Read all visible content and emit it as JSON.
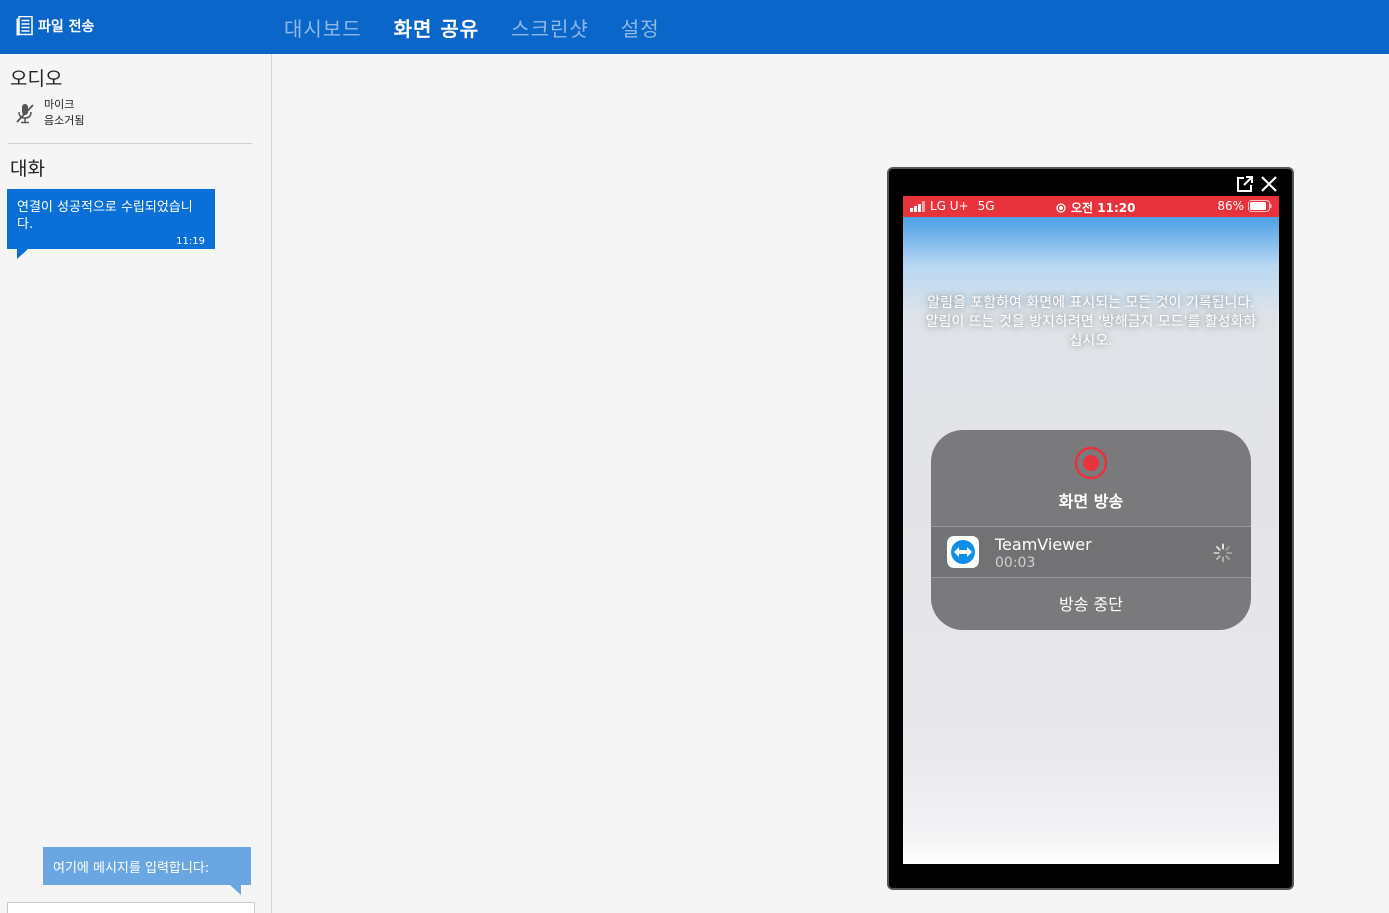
{
  "header": {
    "file_transfer_label": "파일 전송",
    "tabs": [
      {
        "label": "대시보드",
        "active": false
      },
      {
        "label": "화면 공유",
        "active": true
      },
      {
        "label": "스크린샷",
        "active": false
      },
      {
        "label": "설정",
        "active": false
      }
    ]
  },
  "sidebar": {
    "audio_title": "오디오",
    "mic": {
      "line1": "마이크",
      "line2": "음소거됨",
      "icon": "mic-muted-icon"
    },
    "chat_title": "대화",
    "messages": [
      {
        "text": "연결이 성공적으로 수립되었습니다.",
        "time": "11:19"
      }
    ],
    "input_placeholder": "여기에 메시지를 입력합니다:"
  },
  "phone": {
    "status": {
      "carrier": "LG U+",
      "network": "5G",
      "time": "오전 11:20",
      "battery": "86%"
    },
    "notice": "알림을 포함하여 화면에 표시되는 모든 것이 기록됩니다. 알림이 뜨는 것을 방지하려면 '방해금지 모드'를 활성화하십시오.",
    "panel": {
      "title": "화면 방송",
      "app_name": "TeamViewer",
      "elapsed": "00:03",
      "stop_label": "방송 중단"
    }
  },
  "colors": {
    "brand": "#0a66c8",
    "bubble": "#0a6fd6",
    "input": "#6aa7e2",
    "recording": "#e8323c"
  }
}
